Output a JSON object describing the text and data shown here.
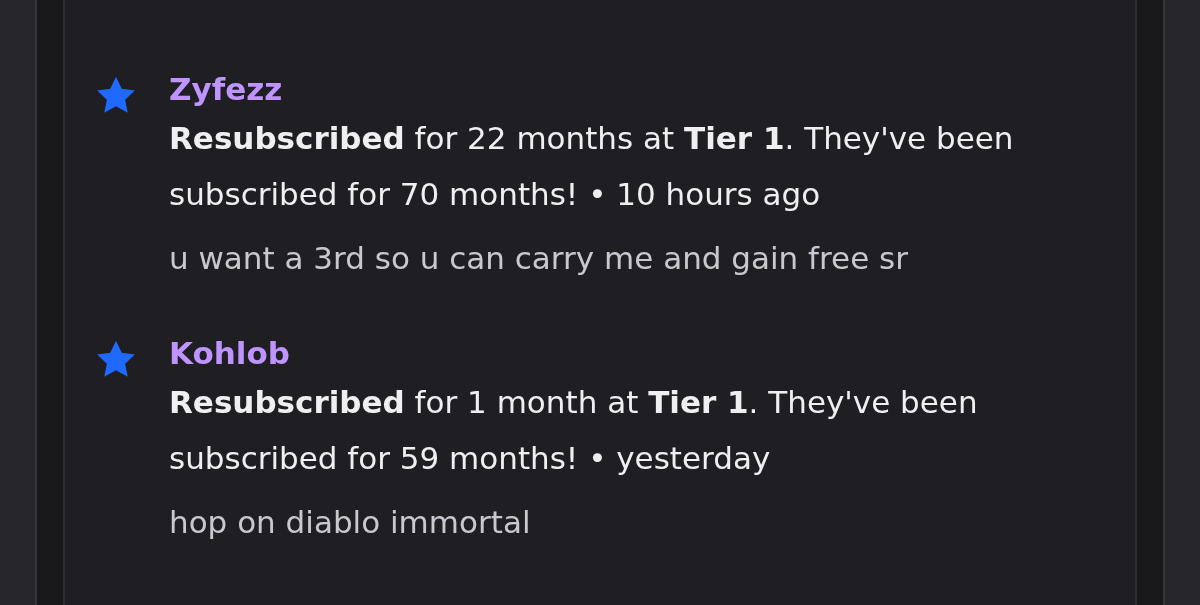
{
  "events": [
    {
      "username": "Zyfezz",
      "text": "**Resubscribed** for 22 months at **Tier 1**. They've been subscribed for 70 months! • 10 hours ago",
      "message": "u want a 3rd so u can carry me and gain free sr"
    },
    {
      "username": "Kohlob",
      "text": "**Resubscribed** for 1 month at **Tier 1**. They've been subscribed for 59 months! • yesterday",
      "message": "hop on diablo immortal"
    }
  ]
}
